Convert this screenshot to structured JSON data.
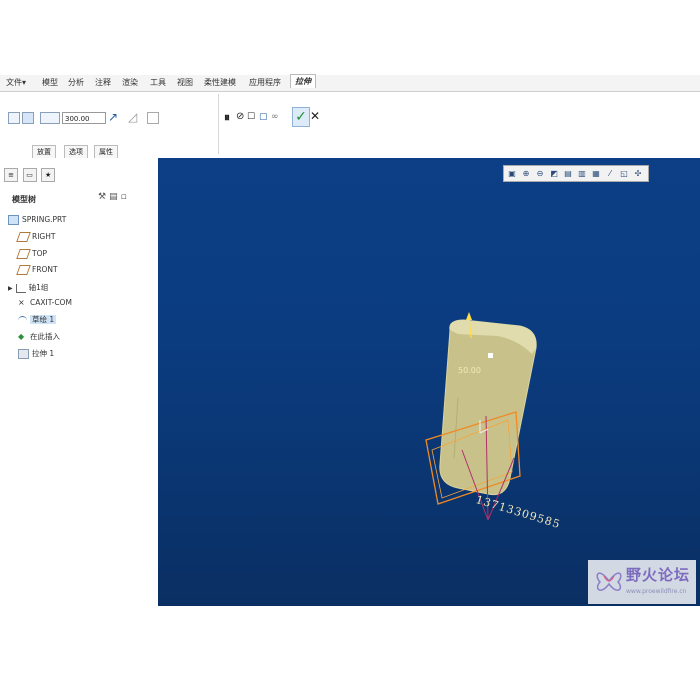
{
  "menu": [
    "文件▾",
    "模型",
    "分析",
    "注释",
    "渲染",
    "工具",
    "视图",
    "柔性建模",
    "应用程序"
  ],
  "active_tab": "拉伸",
  "ribbon": {
    "depth_value": "300.00",
    "subtabs": [
      "放置",
      "选项",
      "属性"
    ]
  },
  "model_tree": {
    "title": "模型树",
    "items": [
      "SPRING.PRT",
      "RIGHT",
      "TOP",
      "FRONT",
      "轴1组",
      "CAXIT-COM",
      "草绘 1",
      "在此插入",
      "拉伸 1"
    ]
  },
  "viewport": {
    "dimension_label": "50.00",
    "phone_watermark": "13713309585"
  },
  "forum": {
    "name": "野火论坛",
    "url": "www.proewildfire.cn"
  },
  "colors": {
    "accent": "#0c3f86",
    "ok_green": "#1c8f2a",
    "model": "#c9c38a"
  }
}
